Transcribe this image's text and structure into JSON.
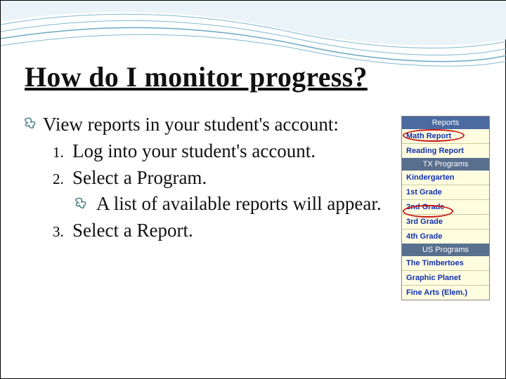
{
  "title": "How do I monitor progress?",
  "bullet": {
    "lead": "View reports in your student's account:"
  },
  "steps": {
    "n1": "1.",
    "s1": "Log into your student's account.",
    "n2": "2.",
    "s2": "Select a Program.",
    "s2a": "A list of available reports will appear.",
    "n3": "3.",
    "s3": "Select a Report."
  },
  "sidebar": {
    "reports_header": "Reports",
    "reports": {
      "r1": "Math Report",
      "r2": "Reading Report"
    },
    "tx_header": "TX Programs",
    "tx": {
      "g0": "Kindergarten",
      "g1": "1st Grade",
      "g2": "2nd Grade",
      "g3": "3rd Grade",
      "g4": "4th Grade"
    },
    "us_header": "US Programs",
    "us": {
      "u1": "The Timbertoes",
      "u2": "Graphic Planet",
      "u3": "Fine Arts (Elem.)"
    }
  }
}
